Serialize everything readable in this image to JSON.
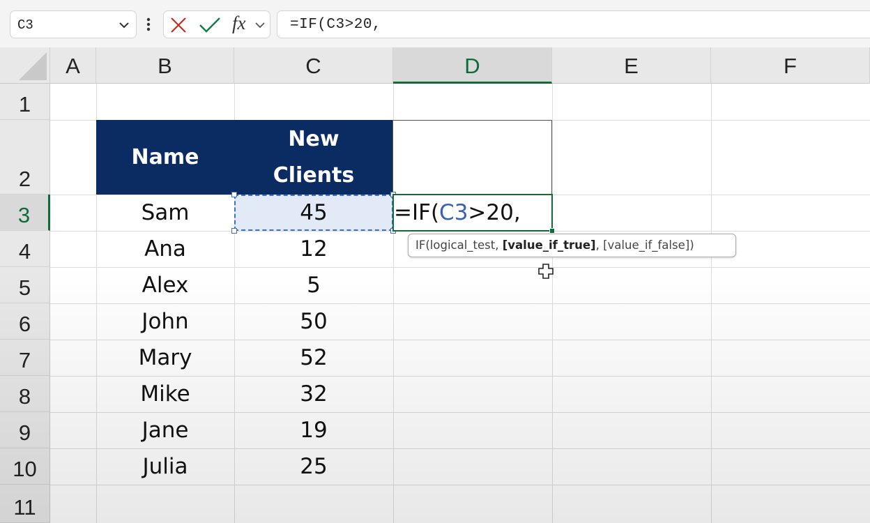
{
  "formula_bar": {
    "name_box": "C3",
    "formula": "=IF(C3>20,",
    "fx_label": "fx"
  },
  "columns": [
    "A",
    "B",
    "C",
    "D",
    "E",
    "F"
  ],
  "rows": [
    "1",
    "2",
    "3",
    "4",
    "5",
    "6",
    "7",
    "8",
    "9",
    "10",
    "11"
  ],
  "active": {
    "column": "D",
    "row": "3"
  },
  "table": {
    "header_name": "Name",
    "header_clients_line1": "New",
    "header_clients_line2": "Clients",
    "names": [
      "Sam",
      "Ana",
      "Alex",
      "John",
      "Mary",
      "Mike",
      "Jane",
      "Julia"
    ],
    "clients": [
      "45",
      "12",
      "5",
      "50",
      "52",
      "32",
      "19",
      "25"
    ]
  },
  "editing": {
    "prefix": "=IF(",
    "ref": "C3",
    "suffix": ">20,"
  },
  "tooltip": {
    "pre": "IF(logical_test, ",
    "bold": "[value_if_true]",
    "post": ", [value_if_false])"
  },
  "colors": {
    "header_fill": "#0b2b63",
    "accent_green": "#0f6b3a",
    "reference_blue": "#3661b8",
    "cancel_red": "#c42b1c",
    "enter_green": "#107c41"
  }
}
